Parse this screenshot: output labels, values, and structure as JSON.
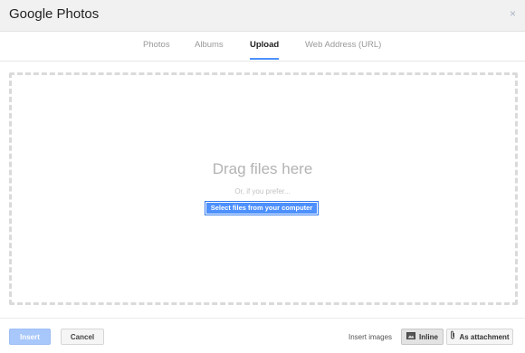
{
  "dialog": {
    "title": "Google Photos",
    "close_label": "×"
  },
  "tabs": [
    {
      "label": "Photos",
      "active": false
    },
    {
      "label": "Albums",
      "active": false
    },
    {
      "label": "Upload",
      "active": true
    },
    {
      "label": "Web Address (URL)",
      "active": false
    }
  ],
  "upload": {
    "drag_text": "Drag files here",
    "or_text": "Or, if you prefer...",
    "select_button": "Select files from your computer"
  },
  "footer": {
    "insert_button": "Insert",
    "cancel_button": "Cancel",
    "insert_images_label": "Insert images",
    "inline_button": "Inline",
    "attachment_button": "As attachment",
    "inline_selected": true
  },
  "icons": {
    "close": "close-icon",
    "inline": "image-icon",
    "attachment": "paperclip-icon"
  },
  "colors": {
    "accent": "#4d90fe",
    "header_bg": "#f1f1f1",
    "disabled_insert": "#a8c7fa"
  }
}
